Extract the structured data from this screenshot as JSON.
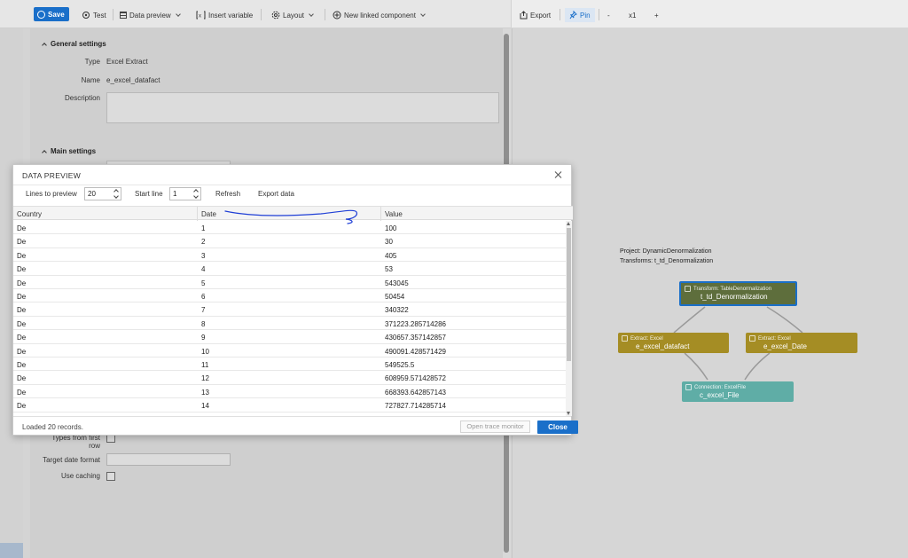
{
  "toolbar": {
    "save_label": "Save",
    "test_label": "Test",
    "data_preview_label": "Data preview",
    "insert_variable_label": "Insert variable",
    "layout_label": "Layout",
    "new_linked_label": "New linked component"
  },
  "right_toolbar": {
    "export_label": "Export",
    "pin_label": "Pin",
    "zoom_out": "-",
    "zoom_level": "x1",
    "zoom_in": "+"
  },
  "properties": {
    "general_title": "General settings",
    "type_label": "Type",
    "type_value": "Excel Extract",
    "name_label": "Name",
    "name_value": "e_excel_datafact",
    "description_label": "Description",
    "main_title": "Main settings",
    "types_first_row_label_1": "Types from first",
    "types_first_row_label_2": "row",
    "target_date_label": "Target date format",
    "use_caching_label": "Use caching"
  },
  "canvas": {
    "project_line_prefix": "Project: ",
    "project_name": "DynamicDenormalization",
    "transforms_line_prefix": "Transforms: ",
    "transforms_name": "t_td_Denormalization",
    "nodes": {
      "transform_type": "Transform: TableDenormalization",
      "transform_name": "t_td_Denormalization",
      "extract1_type": "Extract: Excel",
      "extract1_name": "e_excel_datafact",
      "extract2_type": "Extract: Excel",
      "extract2_name": "e_excel_Date",
      "connection_type": "Connection: ExcelFile",
      "connection_name": "c_excel_File"
    },
    "colors": {
      "transform": "#5e6e3c",
      "extract": "#a58d24",
      "connection": "#5fada6",
      "selected_border": "#1a6fc9"
    }
  },
  "modal": {
    "title": "DATA PREVIEW",
    "lines_label": "Lines to preview",
    "lines_value": "20",
    "start_line_label": "Start line",
    "start_line_value": "1",
    "refresh_label": "Refresh",
    "export_label": "Export data",
    "columns": [
      "Country",
      "Date",
      "Value"
    ],
    "rows": [
      [
        "De",
        "1",
        "100"
      ],
      [
        "De",
        "2",
        "30"
      ],
      [
        "De",
        "3",
        "405"
      ],
      [
        "De",
        "4",
        "53"
      ],
      [
        "De",
        "5",
        "543045"
      ],
      [
        "De",
        "6",
        "50454"
      ],
      [
        "De",
        "7",
        "340322"
      ],
      [
        "De",
        "8",
        "371223.285714286"
      ],
      [
        "De",
        "9",
        "430657.357142857"
      ],
      [
        "De",
        "10",
        "490091.428571429"
      ],
      [
        "De",
        "11",
        "549525.5"
      ],
      [
        "De",
        "12",
        "608959.571428572"
      ],
      [
        "De",
        "13",
        "668393.642857143"
      ],
      [
        "De",
        "14",
        "727827.714285714"
      ]
    ],
    "status": "Loaded 20 records.",
    "trace_label": "Open trace monitor",
    "close_label": "Close"
  }
}
